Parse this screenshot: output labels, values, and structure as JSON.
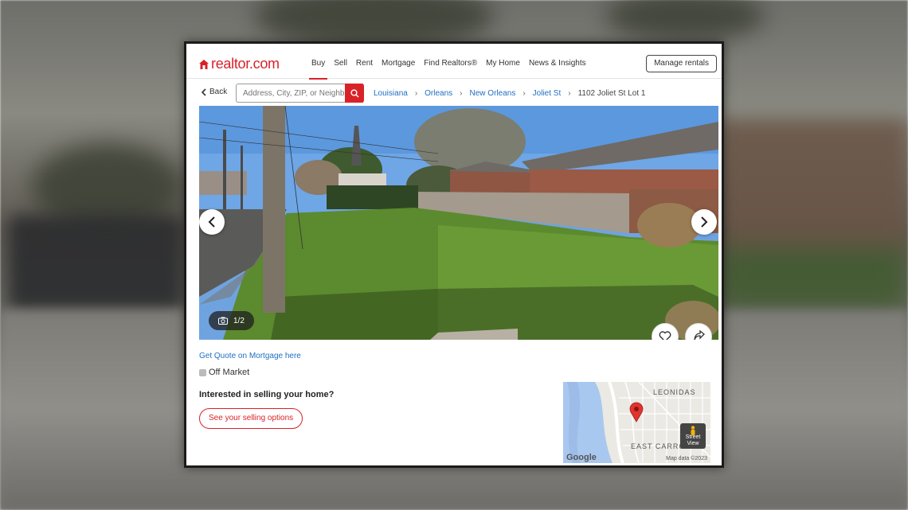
{
  "brand": {
    "logo_text": "realtor.com",
    "accent": "#d92228"
  },
  "nav": {
    "items": [
      {
        "label": "Buy",
        "active": true
      },
      {
        "label": "Sell"
      },
      {
        "label": "Rent"
      },
      {
        "label": "Mortgage"
      },
      {
        "label": "Find Realtors®"
      },
      {
        "label": "My Home"
      },
      {
        "label": "News & Insights"
      }
    ],
    "manage_rentals": "Manage rentals"
  },
  "subbar": {
    "back_label": "Back",
    "search_placeholder": "Address, City, ZIP, or Neighborhood",
    "breadcrumbs": [
      "Louisiana",
      "Orleans",
      "New Orleans",
      "Joliet St",
      "1102 Joliet St Lot 1"
    ]
  },
  "gallery": {
    "counter": "1/2"
  },
  "listing": {
    "mortgage_link": "Get Quote on Mortgage here",
    "status": "Off Market",
    "sell_question": "Interested in selling your home?",
    "sell_button": "See your selling options"
  },
  "map": {
    "label_top": "LEONIDAS",
    "label_bottom": "EAST CARRO",
    "street_view": "Street View",
    "google": "Google",
    "map_data": "Map data ©2023"
  },
  "icons": [
    "house-logo-icon",
    "chevron-left-icon",
    "search-icon",
    "camera-icon",
    "heart-icon",
    "share-icon",
    "map-pin-icon",
    "pegman-icon"
  ]
}
